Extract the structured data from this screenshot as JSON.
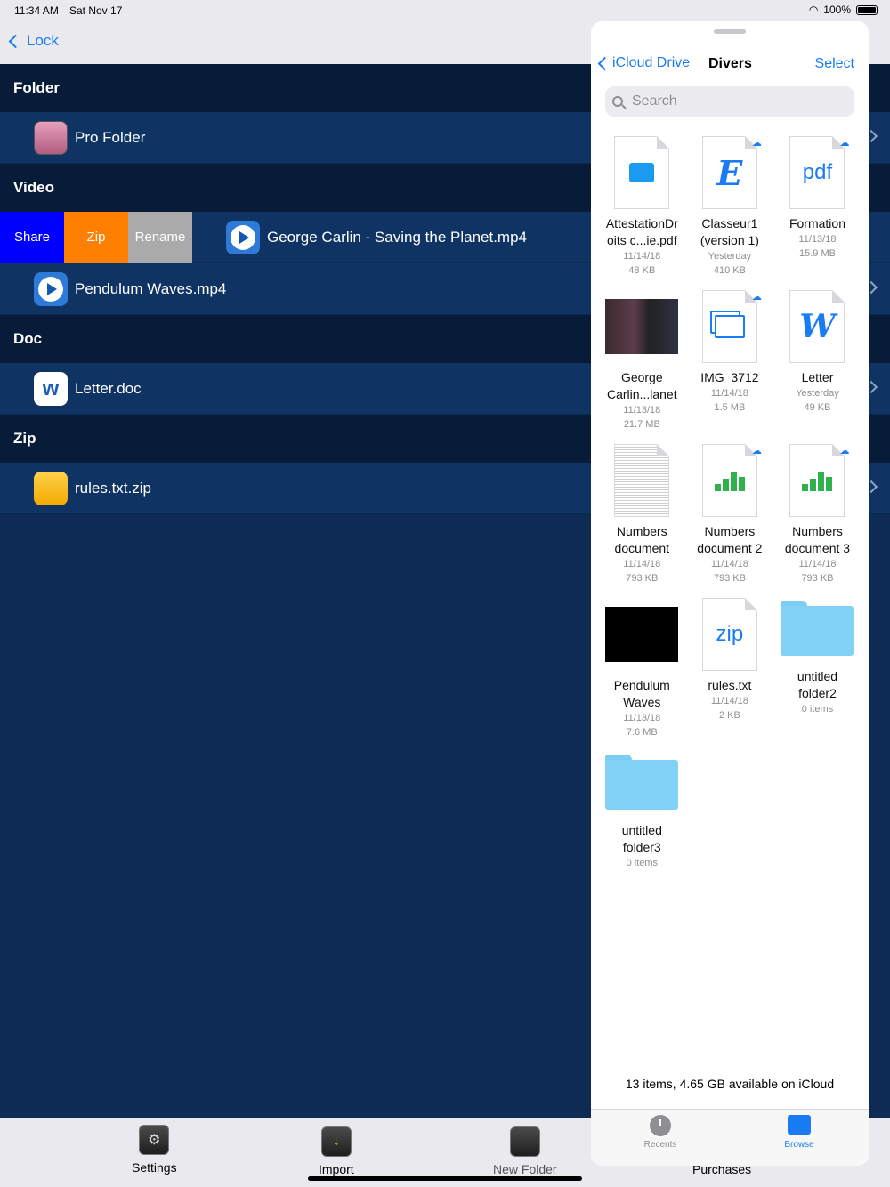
{
  "status": {
    "time": "11:34 AM",
    "date": "Sat Nov 17",
    "battery": "100%"
  },
  "nav": {
    "back_label": "Lock"
  },
  "sections": {
    "folder": {
      "title": "Folder",
      "items": [
        "Pro Folder"
      ]
    },
    "video": {
      "title": "Video",
      "swipe_actions": [
        "Share",
        "Zip",
        "Rename"
      ],
      "items": [
        "George Carlin - Saving the Planet.mp4",
        "Pendulum Waves.mp4"
      ]
    },
    "doc": {
      "title": "Doc",
      "items": [
        "Letter.doc"
      ]
    },
    "zip": {
      "title": "Zip",
      "items": [
        "rules.txt.zip"
      ]
    }
  },
  "toolbar": {
    "items": [
      "Settings",
      "Import",
      "New Folder",
      "Purchases"
    ]
  },
  "picker": {
    "back_label": "iCloud Drive",
    "title": "Divers",
    "select_label": "Select",
    "search_placeholder": "Search",
    "files": [
      {
        "name1": "AttestationDr",
        "name2": "oits c...ie.pdf",
        "date": "11/14/18",
        "size": "48 KB"
      },
      {
        "name1": "Classeur1",
        "name2": "(version 1)",
        "date": "Yesterday",
        "size": "410 KB",
        "glyph": "E"
      },
      {
        "name1": "Formation",
        "name2": "",
        "date": "11/13/18",
        "size": "15.9 MB",
        "glyph": "pdf"
      },
      {
        "name1": "George",
        "name2": "Carlin...lanet",
        "date": "11/13/18",
        "size": "21.7 MB"
      },
      {
        "name1": "IMG_3712",
        "name2": "",
        "date": "11/14/18",
        "size": "1.5 MB"
      },
      {
        "name1": "Letter",
        "name2": "",
        "date": "Yesterday",
        "size": "49 KB",
        "glyph": "W"
      },
      {
        "name1": "Numbers",
        "name2": "document",
        "date": "11/14/18",
        "size": "793 KB"
      },
      {
        "name1": "Numbers",
        "name2": "document 2",
        "date": "11/14/18",
        "size": "793 KB"
      },
      {
        "name1": "Numbers",
        "name2": "document 3",
        "date": "11/14/18",
        "size": "793 KB"
      },
      {
        "name1": "Pendulum",
        "name2": "Waves",
        "date": "11/13/18",
        "size": "7.6 MB"
      },
      {
        "name1": "rules.txt",
        "name2": "",
        "date": "11/14/18",
        "size": "2 KB",
        "glyph": "zip"
      },
      {
        "name1": "untitled",
        "name2": "folder2",
        "date": "",
        "size": "0 items"
      },
      {
        "name1": "untitled",
        "name2": "folder3",
        "date": "",
        "size": "0 items"
      }
    ],
    "footer": "13 items, 4.65 GB available on iCloud",
    "tabs": [
      "Recents",
      "Browse"
    ]
  },
  "colors": {
    "accent": "#1a7cf4",
    "list_bg": "#0f3464",
    "header_bg": "#081c3a",
    "share": "#0000ff",
    "zip": "#ff8000",
    "rename": "#aaaaaa"
  }
}
